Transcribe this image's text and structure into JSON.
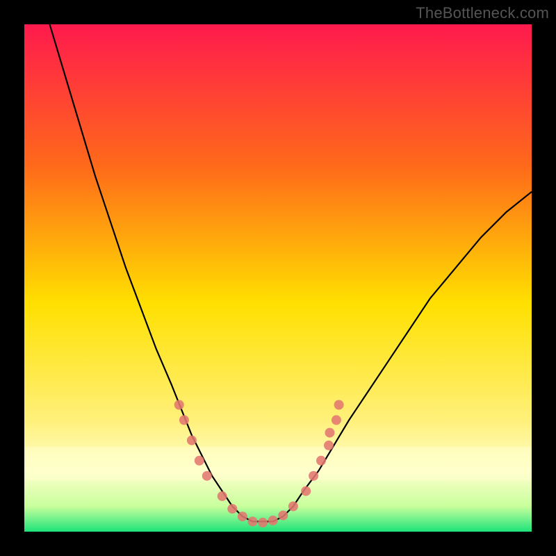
{
  "watermark": "TheBottleneck.com",
  "chart_data": {
    "type": "line",
    "title": "",
    "xlabel": "",
    "ylabel": "",
    "xlim": [
      0,
      100
    ],
    "ylim": [
      0,
      100
    ],
    "background_gradient": {
      "top": "#ff1a4d",
      "mid_upper": "#ff8a00",
      "mid": "#ffe000",
      "mid_lower": "#fff59b",
      "band": "#ffffcc",
      "bottom": "#1de37a"
    },
    "series": [
      {
        "name": "bottleneck-curve",
        "color": "#000000",
        "x": [
          5,
          8,
          11,
          14,
          17,
          20,
          23,
          26,
          29,
          31,
          33,
          35,
          37,
          39,
          41,
          43,
          45,
          47,
          49,
          51,
          53,
          55,
          58,
          61,
          64,
          68,
          72,
          76,
          80,
          85,
          90,
          95,
          100
        ],
        "y": [
          100,
          90,
          80,
          70,
          61,
          52,
          44,
          36,
          29,
          24,
          19,
          15,
          11,
          8,
          5,
          3,
          2,
          2,
          2,
          3,
          5,
          8,
          12,
          17,
          22,
          28,
          34,
          40,
          46,
          52,
          58,
          63,
          67
        ]
      }
    ],
    "markers": {
      "name": "sample-points",
      "color": "#e3776f",
      "radius_px": 7,
      "points": [
        {
          "x": 30.5,
          "y": 25.0
        },
        {
          "x": 31.5,
          "y": 22.0
        },
        {
          "x": 33.0,
          "y": 18.0
        },
        {
          "x": 34.5,
          "y": 14.0
        },
        {
          "x": 36.0,
          "y": 11.0
        },
        {
          "x": 39.0,
          "y": 7.0
        },
        {
          "x": 41.0,
          "y": 4.5
        },
        {
          "x": 43.0,
          "y": 3.0
        },
        {
          "x": 45.0,
          "y": 2.0
        },
        {
          "x": 47.0,
          "y": 1.8
        },
        {
          "x": 49.0,
          "y": 2.2
        },
        {
          "x": 51.0,
          "y": 3.2
        },
        {
          "x": 53.0,
          "y": 5.0
        },
        {
          "x": 55.5,
          "y": 8.0
        },
        {
          "x": 57.0,
          "y": 11.0
        },
        {
          "x": 58.5,
          "y": 14.0
        },
        {
          "x": 60.0,
          "y": 17.0
        },
        {
          "x": 60.2,
          "y": 19.5
        },
        {
          "x": 61.5,
          "y": 22.0
        },
        {
          "x": 62.0,
          "y": 25.0
        }
      ]
    }
  }
}
